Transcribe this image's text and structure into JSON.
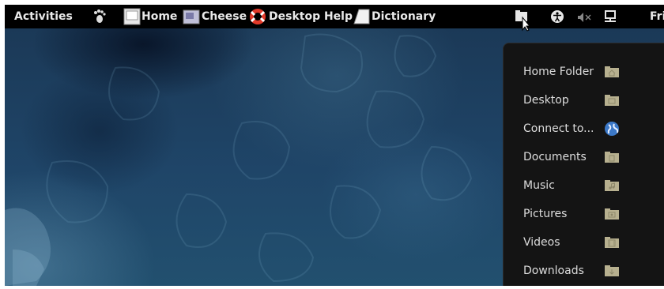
{
  "topbar": {
    "activities": "Activities",
    "apps": [
      {
        "label": "Home",
        "icon": "home-folder-icon"
      },
      {
        "label": "Cheese",
        "icon": "cheese-icon"
      },
      {
        "label": "Desktop Help",
        "icon": "help-lifebuoy-icon"
      },
      {
        "label": "Dictionary",
        "icon": "dictionary-icon"
      }
    ],
    "status_icons": [
      "places-folder-icon",
      "accessibility-icon",
      "volume-muted-icon",
      "network-icon"
    ],
    "clock": "Fri"
  },
  "places_menu": {
    "items": [
      {
        "label": "Home Folder",
        "icon": "home-folder-icon"
      },
      {
        "label": "Desktop",
        "icon": "desktop-folder-icon"
      },
      {
        "label": "Connect to...",
        "icon": "globe-icon"
      },
      {
        "label": "Documents",
        "icon": "documents-folder-icon"
      },
      {
        "label": "Music",
        "icon": "music-folder-icon"
      },
      {
        "label": "Pictures",
        "icon": "pictures-folder-icon"
      },
      {
        "label": "Videos",
        "icon": "videos-folder-icon"
      },
      {
        "label": "Downloads",
        "icon": "downloads-folder-icon"
      }
    ]
  },
  "colors": {
    "panel": "#000000",
    "menu_bg": "#141414",
    "menu_text": "#dcdcdc",
    "folder": "#b7b08f",
    "desktop": "#1f4568"
  }
}
